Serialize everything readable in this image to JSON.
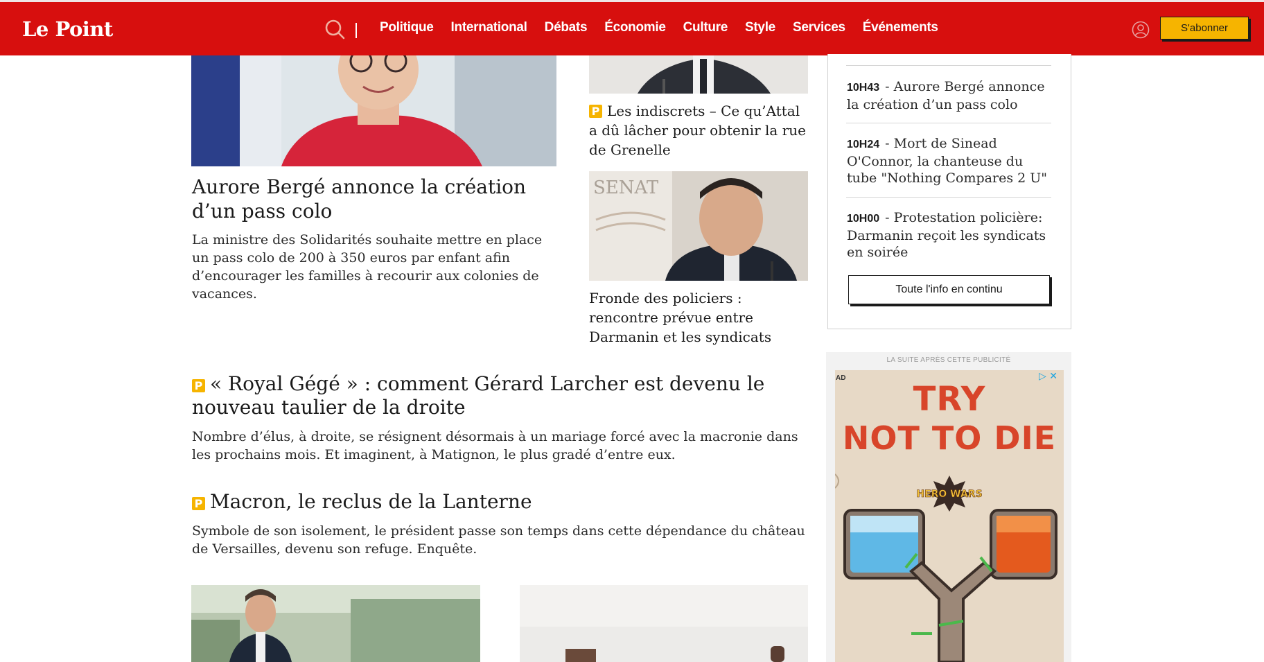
{
  "brand": {
    "logo": "Le Point",
    "accent": "#d70f0e",
    "highlight": "#f6b400"
  },
  "nav": {
    "items": [
      "Politique",
      "International",
      "Débats",
      "Économie",
      "Culture",
      "Style",
      "Services",
      "Événements"
    ],
    "subscribe_label": "S'abonner"
  },
  "articles": {
    "lead": {
      "title": "Aurore Bergé annonce la création d’un pass colo",
      "summary": "La ministre des Solidarités souhaite mettre en place un pass colo de 200 à 350 euros par enfant afin d’encourager les familles à recourir aux colonies de vacances."
    },
    "side_1": {
      "premium_mark": "P",
      "title": "Les indiscrets – Ce qu’Attal a dû lâcher pour obtenir la rue de Grenelle"
    },
    "side_2": {
      "title": "Fronde des policiers : rencontre prévue entre Darmanin et les syndicats"
    },
    "feature_1": {
      "premium_mark": "P",
      "title": "« Royal Gégé » : comment Gérard Larcher est devenu le nouveau taulier de la droite",
      "summary": "Nombre d’élus, à droite, se résignent désormais à un mariage forcé avec la macronie dans les prochains mois. Et imaginent, à Matignon, le plus gradé d’entre eux."
    },
    "feature_2": {
      "premium_mark": "P",
      "title": "Macron, le reclus de la Lanterne",
      "summary": "Symbole de son isolement, le président passe son temps dans cette dépendance du château de Versailles, devenu son refuge. Enquête."
    }
  },
  "live": {
    "items": [
      {
        "time": "10H43",
        "text": "- Aurore Bergé annonce la création d’un pass colo"
      },
      {
        "time": "10H24",
        "text": "- Mort de Sinead O'Connor, la chanteuse du tube \"Nothing Compares 2 U\""
      },
      {
        "time": "10H00",
        "text": "- Protestation policière: Darmanin reçoit les syndicats en soirée"
      }
    ],
    "button_label": "Toute l'info en continu"
  },
  "ad": {
    "notice": "LA SUITE APRÈS CETTE PUBLICITÉ",
    "badge": "AD",
    "controls": "▷ ✕",
    "headline_1": "TRY",
    "headline_2": "NOT TO DIE",
    "brand": "HERO WARS"
  }
}
